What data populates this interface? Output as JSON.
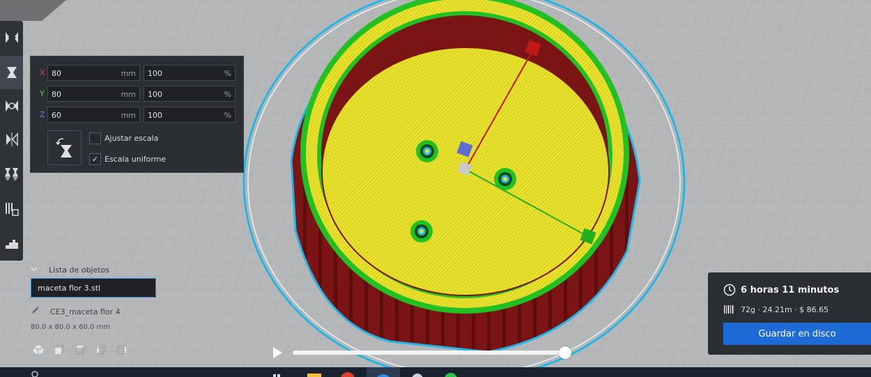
{
  "scale_panel": {
    "rows": [
      {
        "axis": "X",
        "axis_color": "#e03a3a",
        "mm_value": "80",
        "mm_unit": "mm",
        "pct_value": "100",
        "pct_unit": "%"
      },
      {
        "axis": "Y",
        "axis_color": "#5ccf3c",
        "mm_value": "80",
        "mm_unit": "mm",
        "pct_value": "100",
        "pct_unit": "%"
      },
      {
        "axis": "Z",
        "axis_color": "#5f7de0",
        "mm_value": "60",
        "mm_unit": "mm",
        "pct_value": "100",
        "pct_unit": "%"
      }
    ],
    "snap_scaling_label": "Ajustar escala",
    "snap_scaling_checked": false,
    "uniform_scaling_label": "Escala uniforme",
    "uniform_scaling_checked": true,
    "check_mark": "✓"
  },
  "object_list": {
    "header": "Lista de objetos",
    "selected_file": "maceta flor 3.stl",
    "object_name": "CE3_maceta flor 4",
    "dimensions": "80.0 x 80.0 x 60.0 mm"
  },
  "print_info": {
    "time": "6 horas 11 minutos",
    "material": "72g · 24.21m · $ 86.65",
    "save_button": "Guardar en disco"
  },
  "layer_slider": {
    "progress": 1.0
  },
  "colors": {
    "accent": "#1e6bd8",
    "panel_bg": "#2b2e33",
    "model_wall": "#7b1414",
    "model_infill": "#e6e02a",
    "skirt": "#1fb7e8",
    "outer_wall": "#22c022"
  },
  "icons": {
    "toolbar": [
      "move-icon",
      "scale-icon",
      "rotate-icon",
      "mirror-icon",
      "per-model-settings-icon",
      "support-blocker-icon",
      "layer-view-icon"
    ],
    "view": [
      "3d-view-icon",
      "front-view-icon",
      "top-view-icon",
      "left-view-icon",
      "right-view-icon"
    ]
  }
}
